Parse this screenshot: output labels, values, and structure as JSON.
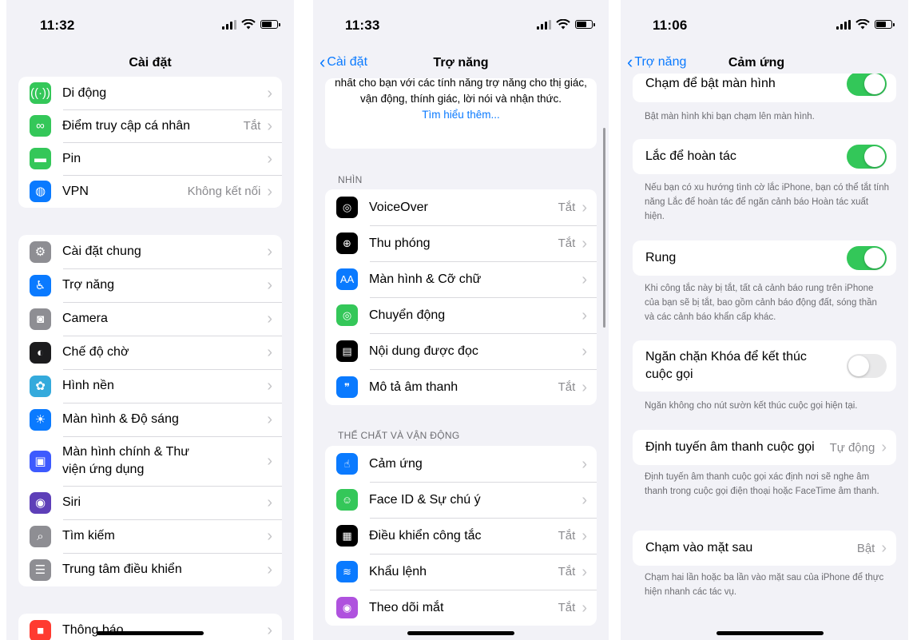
{
  "screen1": {
    "time": "11:32",
    "title": "Cài đặt",
    "group1": [
      {
        "icon": "antenna-icon",
        "glyph": "((·))",
        "color": "#34c759",
        "label": "Di động",
        "value": ""
      },
      {
        "icon": "hotspot-icon",
        "glyph": "∞",
        "color": "#34c759",
        "label": "Điểm truy cập cá nhân",
        "value": "Tắt"
      },
      {
        "icon": "battery-icon",
        "glyph": "▬",
        "color": "#34c759",
        "label": "Pin",
        "value": ""
      },
      {
        "icon": "globe-icon",
        "glyph": "◍",
        "color": "#0a7aff",
        "label": "VPN",
        "value": "Không kết nối"
      }
    ],
    "group2": [
      {
        "icon": "gear-icon",
        "glyph": "⚙",
        "color": "#8e8e93",
        "label": "Cài đặt chung",
        "value": ""
      },
      {
        "icon": "accessibility-icon",
        "glyph": "♿",
        "color": "#0a7aff",
        "label": "Trợ năng",
        "value": ""
      },
      {
        "icon": "camera-icon",
        "glyph": "◙",
        "color": "#8e8e93",
        "label": "Camera",
        "value": ""
      },
      {
        "icon": "standby-icon",
        "glyph": "◐",
        "color": "#1c1c1e",
        "label": "Chế độ chờ",
        "value": ""
      },
      {
        "icon": "wallpaper-icon",
        "glyph": "✿",
        "color": "#34aadc",
        "label": "Hình nền",
        "value": ""
      },
      {
        "icon": "brightness-icon",
        "glyph": "☀",
        "color": "#0a7aff",
        "label": "Màn hình & Độ sáng",
        "value": ""
      },
      {
        "icon": "homescreen-icon",
        "glyph": "▣",
        "color": "#3d5afe",
        "label": "Màn hình chính & Thư viện ứng dụng",
        "value": "",
        "tall": true
      },
      {
        "icon": "siri-icon",
        "glyph": "◉",
        "color": "#5e3fb8",
        "label": "Siri",
        "value": ""
      },
      {
        "icon": "search-icon",
        "glyph": "⌕",
        "color": "#8e8e93",
        "label": "Tìm kiếm",
        "value": ""
      },
      {
        "icon": "control-center-icon",
        "glyph": "☰",
        "color": "#8e8e93",
        "label": "Trung tâm điều khiển",
        "value": ""
      }
    ],
    "group3": [
      {
        "icon": "notification-icon",
        "glyph": "■",
        "color": "#ff3b30",
        "label": "Thông báo",
        "value": ""
      }
    ]
  },
  "screen2": {
    "time": "11:33",
    "back_label": "Cài đặt",
    "title": "Trợ năng",
    "intro_text": "nhất cho bạn với các tính năng trợ năng cho thị giác, vận động, thính giác, lời nói và nhận thức.",
    "intro_link": "Tìm hiểu thêm...",
    "section1_header": "NHÌN",
    "section1": [
      {
        "icon": "voiceover-icon",
        "glyph": "◎",
        "color": "#000000",
        "label": "VoiceOver",
        "value": "Tắt"
      },
      {
        "icon": "zoom-icon",
        "glyph": "⊕",
        "color": "#000000",
        "label": "Thu phóng",
        "value": "Tắt"
      },
      {
        "icon": "text-size-icon",
        "glyph": "AA",
        "color": "#0a7aff",
        "label": "Màn hình & Cỡ chữ",
        "value": ""
      },
      {
        "icon": "motion-icon",
        "glyph": "◎",
        "color": "#34c759",
        "label": "Chuyển động",
        "value": ""
      },
      {
        "icon": "spoken-content-icon",
        "glyph": "▤",
        "color": "#000000",
        "label": "Nội dung được đọc",
        "value": ""
      },
      {
        "icon": "audio-description-icon",
        "glyph": "❞",
        "color": "#0a7aff",
        "label": "Mô tả âm thanh",
        "value": "Tắt"
      }
    ],
    "section2_header": "THỂ CHẤT VÀ VẬN ĐỘNG",
    "section2": [
      {
        "icon": "touch-icon",
        "glyph": "☝",
        "color": "#0a7aff",
        "label": "Cảm ứng",
        "value": ""
      },
      {
        "icon": "face-id-icon",
        "glyph": "☺",
        "color": "#34c759",
        "label": "Face ID & Sự chú ý",
        "value": ""
      },
      {
        "icon": "switch-control-icon",
        "glyph": "▦",
        "color": "#000000",
        "label": "Điều khiển công tắc",
        "value": "Tắt"
      },
      {
        "icon": "voice-control-icon",
        "glyph": "≋",
        "color": "#0a7aff",
        "label": "Khẩu lệnh",
        "value": "Tắt"
      },
      {
        "icon": "eye-tracking-icon",
        "glyph": "◉",
        "color": "#af52de",
        "label": "Theo dõi mắt",
        "value": "Tắt"
      }
    ]
  },
  "screen3": {
    "time": "11:06",
    "back_label": "Trợ năng",
    "title": "Cảm ứng",
    "tap_wake_label": "Chạm để bật màn hình",
    "tap_wake_desc": "Bật màn hình khi bạn chạm lên màn hình.",
    "shake_label": "Lắc để hoàn tác",
    "shake_desc": "Nếu bạn có xu hướng tình cờ lắc iPhone, bạn có thể tắt tính năng Lắc để hoàn tác để ngăn cảnh báo Hoàn tác xuất hiện.",
    "vibration_label": "Rung",
    "vibration_desc": "Khi công tắc này bị tắt, tất cả cảnh báo rung trên iPhone của bạn sẽ bị tắt, bao gồm cảnh báo động đất, sóng thần và các cảnh báo khẩn cấp khác.",
    "lock_label": "Ngăn chặn Khóa để kết thúc cuộc gọi",
    "lock_desc": "Ngăn không cho nút sườn kết thúc cuộc gọi hiện tại.",
    "audio_routing_label": "Định tuyến âm thanh cuộc gọi",
    "audio_routing_value": "Tự động",
    "audio_routing_desc": "Định tuyến âm thanh cuộc gọi xác định nơi sẽ nghe âm thanh trong cuộc gọi điện thoại hoặc FaceTime âm thanh.",
    "back_tap_label": "Chạm vào mặt sau",
    "back_tap_value": "Bật",
    "back_tap_desc": "Chạm hai lần hoặc ba lần vào mặt sau của iPhone để thực hiện nhanh các tác vụ."
  }
}
